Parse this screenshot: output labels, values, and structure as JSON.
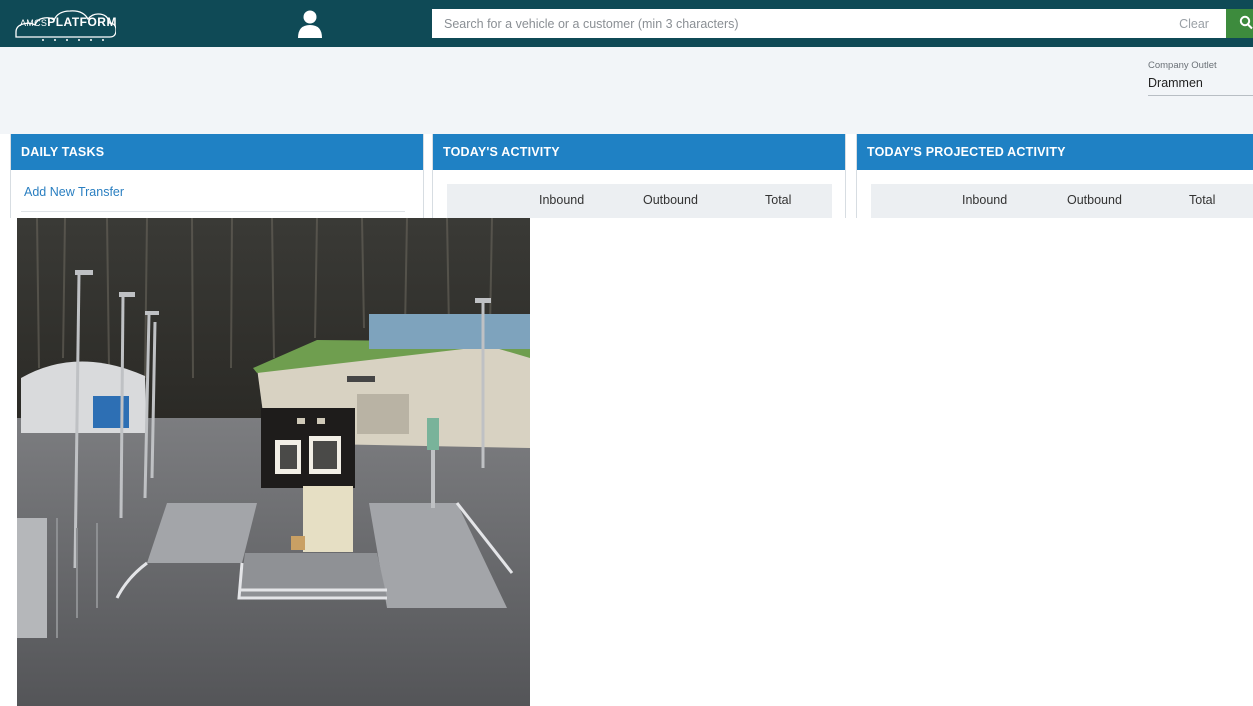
{
  "header": {
    "logo": {
      "prefix": "AMCS",
      "main": "PLATFORM"
    },
    "user_icon": "user-icon",
    "search": {
      "placeholder": "Search for a vehicle or a customer (min 3 characters)",
      "value": "",
      "clear_label": "Clear",
      "button_icon": "search-icon",
      "button_color": "#3d8b3d"
    }
  },
  "outlet": {
    "label": "Company Outlet",
    "value": "Drammen"
  },
  "panels": {
    "daily_tasks": {
      "title": "DAILY TASKS",
      "items": [
        {
          "label": "Add New Transfer"
        }
      ]
    },
    "todays_activity": {
      "title": "TODAY'S ACTIVITY",
      "columns": [
        "Inbound",
        "Outbound",
        "Total"
      ]
    },
    "projected_activity": {
      "title": "TODAY'S PROJECTED ACTIVITY",
      "columns": [
        "Inbound",
        "Outbound",
        "Total"
      ]
    }
  },
  "colors": {
    "topbar": "#0f4a56",
    "panel_header": "#1f81c4",
    "link": "#2a7fc1",
    "band": "#f2f5f8"
  },
  "camera": {
    "icon": "camera-feed-image"
  }
}
